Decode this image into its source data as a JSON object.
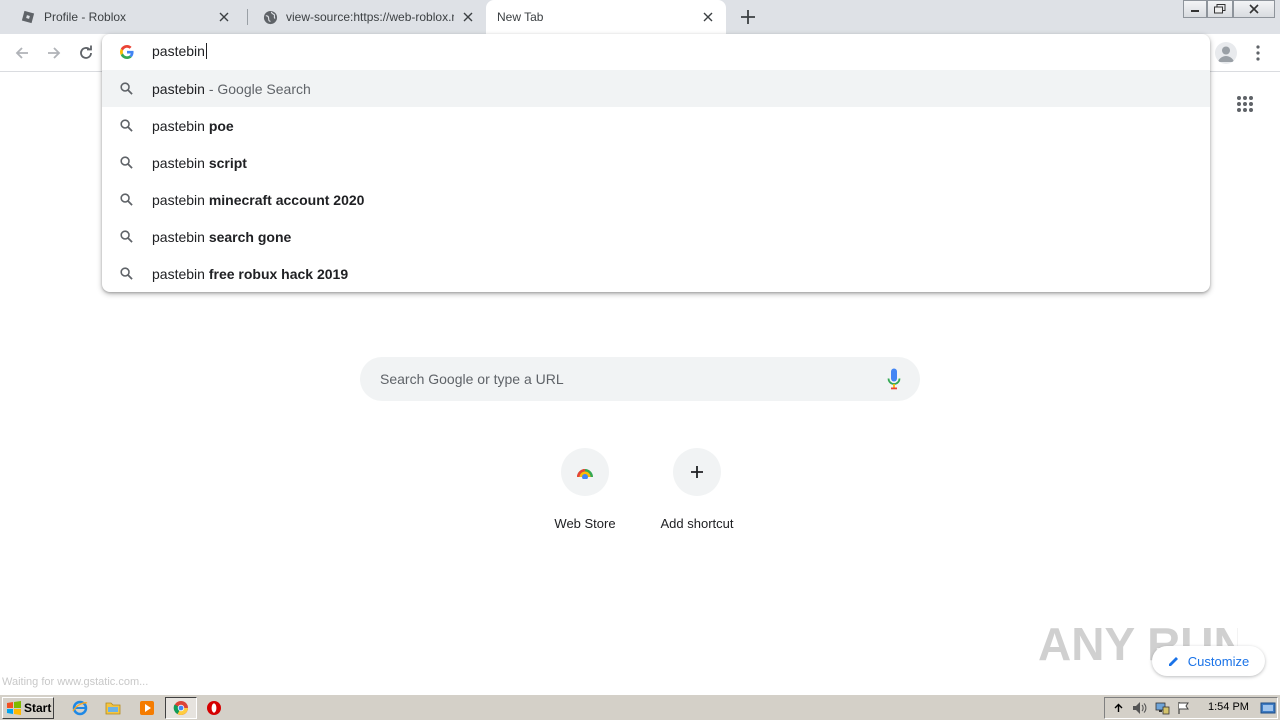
{
  "tabs": [
    {
      "title": "Profile - Roblox",
      "active": false
    },
    {
      "title": "view-source:https://web-roblox.net/users/",
      "active": false
    },
    {
      "title": "New Tab",
      "active": true
    }
  ],
  "omnibox": {
    "input_value": "pastebin",
    "suggestions": [
      {
        "prefix": "pastebin",
        "bold": "",
        "desc": " - Google Search",
        "selected": true
      },
      {
        "prefix": "pastebin ",
        "bold": "poe",
        "desc": ""
      },
      {
        "prefix": "pastebin ",
        "bold": "script",
        "desc": ""
      },
      {
        "prefix": "pastebin ",
        "bold": "minecraft account 2020",
        "desc": ""
      },
      {
        "prefix": "pastebin ",
        "bold": "search gone",
        "desc": ""
      },
      {
        "prefix": "pastebin ",
        "bold": "free robux hack 2019",
        "desc": ""
      }
    ]
  },
  "ntp": {
    "search_placeholder": "Search Google or type a URL",
    "shortcuts": [
      {
        "label": "Web Store"
      },
      {
        "label": "Add shortcut"
      }
    ],
    "customize_label": "Customize"
  },
  "status_text": "Waiting for www.gstatic.com...",
  "watermark_text": "ANY RUN",
  "taskbar": {
    "start_label": "Start",
    "clock": "1:54 PM"
  },
  "colors": {
    "accent": "#1a73e8",
    "tabstrip": "#dee1e6",
    "taskbar": "#d4d0c8"
  }
}
